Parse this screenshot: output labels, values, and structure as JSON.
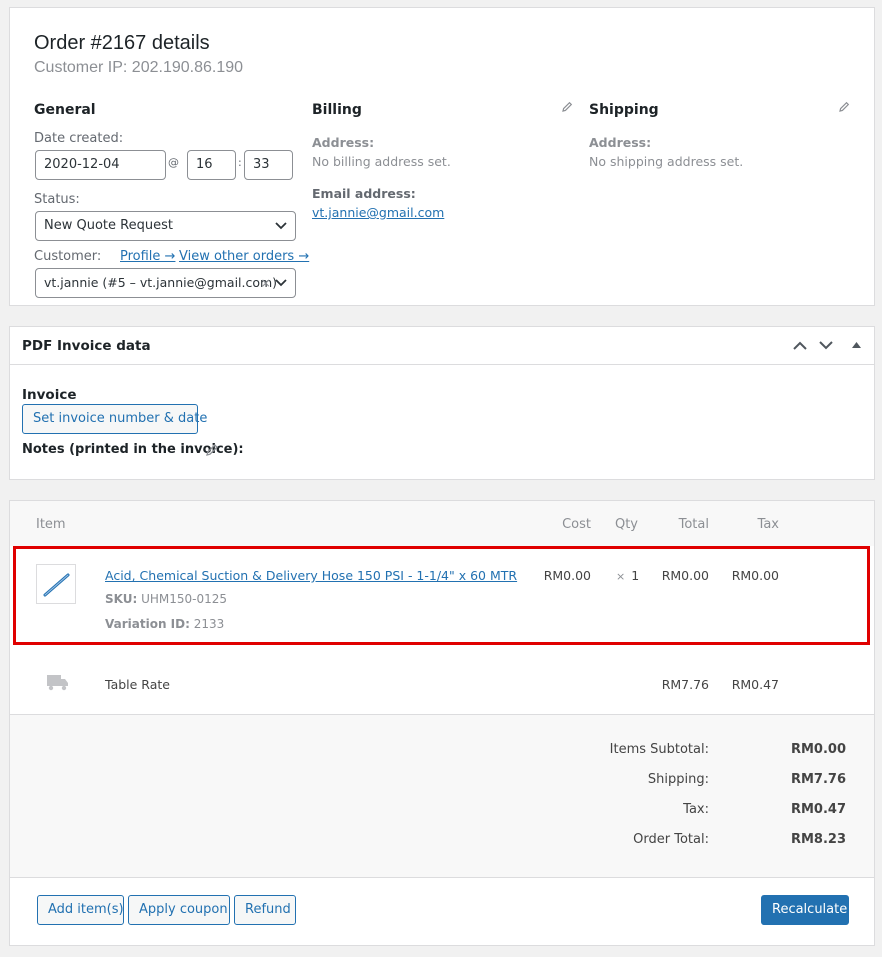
{
  "order": {
    "title": "Order #2167 details",
    "customer_ip": "Customer IP: 202.190.86.190"
  },
  "general": {
    "heading": "General",
    "date_label": "Date created:",
    "date": "2020-12-04",
    "at": "@",
    "hour": "16",
    "colon": ":",
    "minute": "33",
    "status_label": "Status:",
    "status": "New Quote Request",
    "customer_label": "Customer:",
    "profile_link": "Profile →",
    "orders_link": "View other orders →",
    "customer": "vt.jannie (#5 – vt.jannie@gmail.com)",
    "clear": "×"
  },
  "billing": {
    "heading": "Billing",
    "address_label": "Address:",
    "address": "No billing address set.",
    "email_label": "Email address:",
    "email": "vt.jannie@gmail.com"
  },
  "shipping": {
    "heading": "Shipping",
    "address_label": "Address:",
    "address": "No shipping address set."
  },
  "pdf": {
    "title": "PDF Invoice data",
    "invoice_label": "Invoice",
    "set_button": "Set invoice number & date",
    "notes_label": "Notes (printed in the invoice):"
  },
  "items": {
    "headers": {
      "item": "Item",
      "cost": "Cost",
      "qty": "Qty",
      "total": "Total",
      "tax": "Tax"
    },
    "line": {
      "name": "Acid, Chemical Suction & Delivery Hose 150 PSI - 1-1/4\" x 60 MTR",
      "sku_label": "SKU:",
      "sku": "UHM150-0125",
      "variation_label": "Variation ID:",
      "variation": "2133",
      "cost": "RM0.00",
      "qty_x": "×",
      "qty": "1",
      "total": "RM0.00",
      "tax": "RM0.00"
    },
    "shipping_line": {
      "name": "Table Rate",
      "total": "RM7.76",
      "tax": "RM0.47"
    }
  },
  "totals": {
    "subtotal_label": "Items Subtotal:",
    "subtotal": "RM0.00",
    "shipping_label": "Shipping:",
    "shipping": "RM7.76",
    "tax_label": "Tax:",
    "tax": "RM0.47",
    "total_label": "Order Total:",
    "total": "RM8.23"
  },
  "actions": {
    "add_items": "Add item(s)",
    "apply_coupon": "Apply coupon",
    "refund": "Refund",
    "recalculate": "Recalculate"
  },
  "colors": {
    "accent": "#2271b1",
    "highlight": "#e00000"
  },
  "icons": [
    "pencil-icon",
    "chevron-up-icon",
    "chevron-down-icon",
    "triangle-up-icon",
    "chevron-select-icon",
    "product-thumbnail-icon",
    "truck-icon"
  ]
}
